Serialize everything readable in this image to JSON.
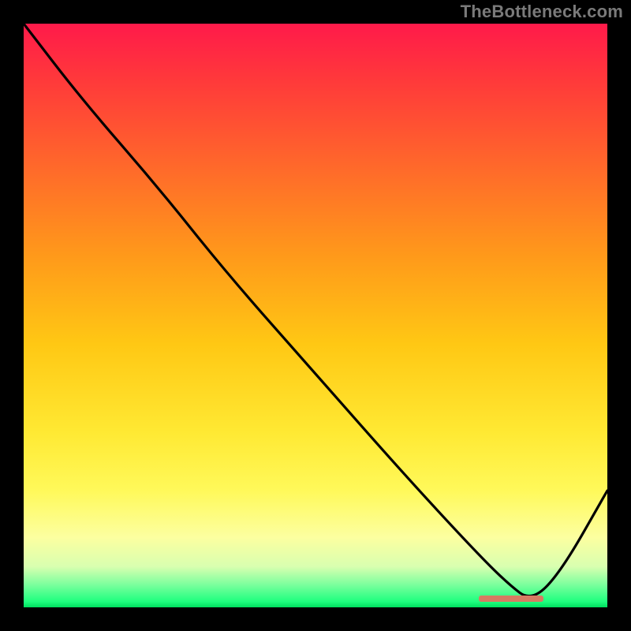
{
  "watermark": "TheBottleneck.com",
  "colors": {
    "background": "#000000",
    "curve": "#000000",
    "marker": "#d67b62",
    "watermark_text": "#7a7a7a"
  },
  "chart_data": {
    "type": "line",
    "title": "",
    "xlabel": "",
    "ylabel": "",
    "xlim": [
      0,
      100
    ],
    "ylim": [
      0,
      100
    ],
    "grid": false,
    "legend": false,
    "note": "No numeric axis ticks or data labels are rendered; x/y expressed as 0–100% of plot width/height. Higher y = higher bottleneck (red); green band at bottom indicates optimal region.",
    "series": [
      {
        "name": "bottleneck-curve",
        "x": [
          0,
          10,
          23,
          35,
          50,
          65,
          77,
          83,
          87,
          92,
          100
        ],
        "y": [
          100,
          87,
          72,
          57,
          40,
          23,
          10,
          4,
          1,
          6,
          20
        ]
      }
    ],
    "optimal_marker": {
      "x_start": 78,
      "x_end": 89,
      "y": 1.5
    },
    "gradient_stops": [
      {
        "pos": 0,
        "color": "#ff1a4a"
      },
      {
        "pos": 10,
        "color": "#ff3a3a"
      },
      {
        "pos": 25,
        "color": "#ff6a2a"
      },
      {
        "pos": 40,
        "color": "#ff9a1a"
      },
      {
        "pos": 55,
        "color": "#ffc814"
      },
      {
        "pos": 70,
        "color": "#ffe933"
      },
      {
        "pos": 80,
        "color": "#fff95a"
      },
      {
        "pos": 88,
        "color": "#fcffa0"
      },
      {
        "pos": 93,
        "color": "#d9ffb0"
      },
      {
        "pos": 96,
        "color": "#7fff9e"
      },
      {
        "pos": 99,
        "color": "#1fff7f"
      },
      {
        "pos": 100,
        "color": "#00e060"
      }
    ]
  }
}
